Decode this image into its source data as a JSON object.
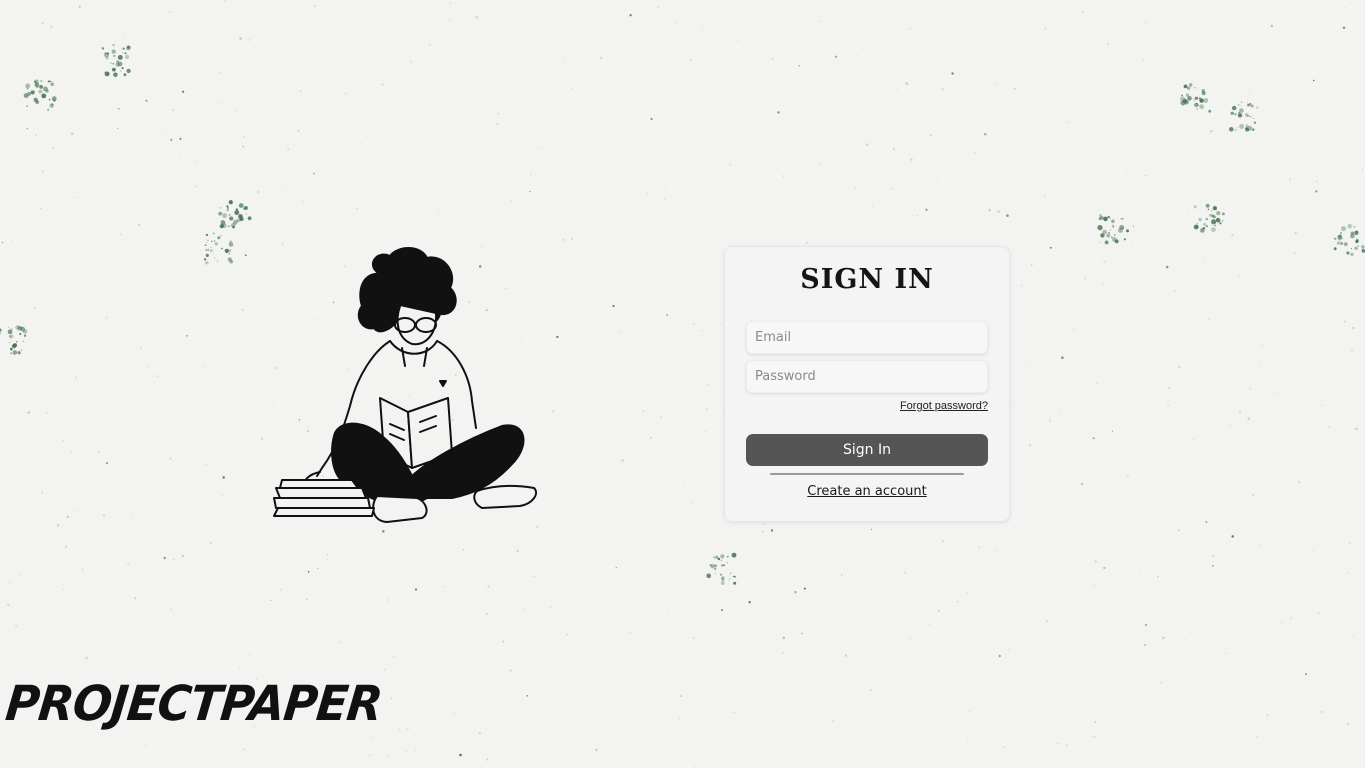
{
  "form": {
    "title": "SIGN IN",
    "email_placeholder": "Email",
    "password_placeholder": "Password",
    "forgot_label": "Forgot password?",
    "signin_label": "Sign In",
    "create_account_label": "Create an account"
  },
  "brand": {
    "logo_text": "PROJECTPAPER"
  },
  "colors": {
    "background": "#f3f3f2",
    "button": "#555555",
    "speckle_green": "#3d6e4a",
    "ink": "#151515"
  },
  "illustration": {
    "icon": "girl-reading-book-illustration"
  }
}
